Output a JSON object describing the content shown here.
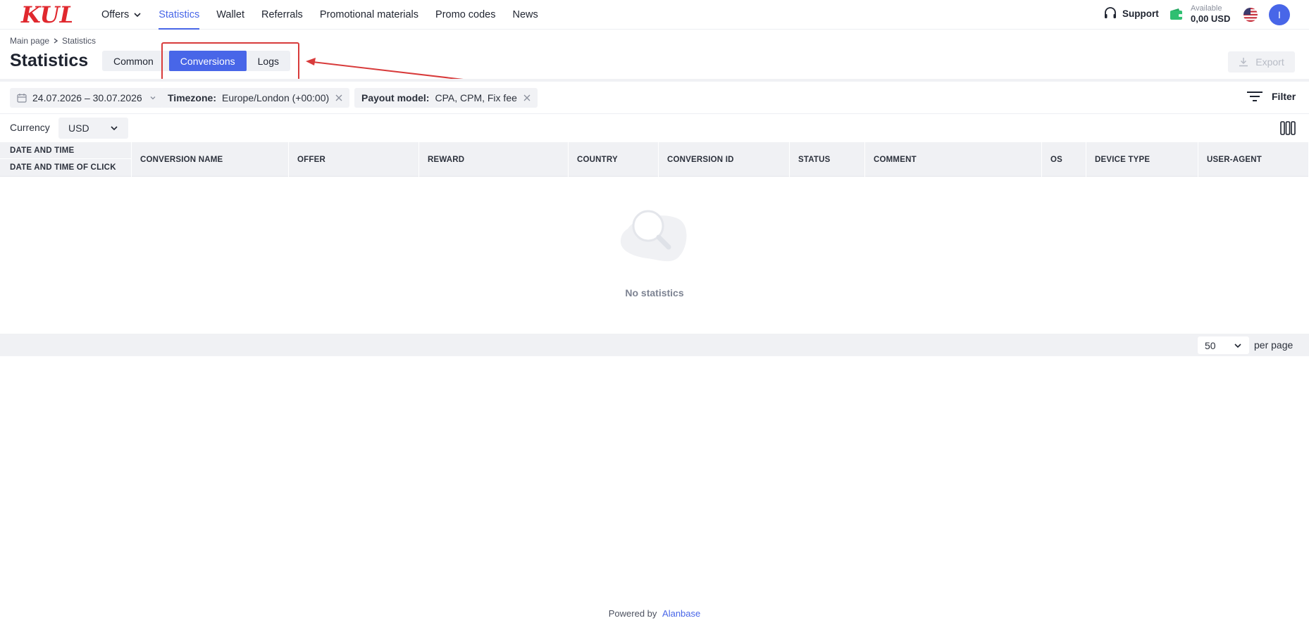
{
  "brand": {
    "logo_text": "KULT",
    "accent": "#4866e8",
    "logo_color": "#e0282e"
  },
  "nav": {
    "items": [
      {
        "label": "Offers",
        "has_dropdown": true
      },
      {
        "label": "Statistics",
        "active": true
      },
      {
        "label": "Wallet"
      },
      {
        "label": "Referrals"
      },
      {
        "label": "Promotional materials"
      },
      {
        "label": "Promo codes"
      },
      {
        "label": "News"
      }
    ]
  },
  "header_right": {
    "support_label": "Support",
    "wallet_label": "Available",
    "wallet_value": "0,00 USD",
    "language_flag": "us-flag-icon",
    "avatar_initial": "I"
  },
  "breadcrumb": {
    "items": [
      "Main page",
      "Statistics"
    ]
  },
  "page": {
    "title": "Statistics",
    "tabs": [
      {
        "label": "Common"
      },
      {
        "label": "Conversions",
        "active": true
      },
      {
        "label": "Logs"
      }
    ],
    "export_label": "Export"
  },
  "filters": {
    "date_range": "24.07.2026 – 30.07.2026",
    "timezone_key": "Timezone:",
    "timezone_value": "Europe/London (+00:00)",
    "payout_key": "Payout model:",
    "payout_value": "CPA, CPM, Fix fee",
    "filter_label": "Filter"
  },
  "currency": {
    "label": "Currency",
    "value": "USD"
  },
  "table": {
    "first_col_top": "DATE AND TIME",
    "first_col_bottom": "DATE AND TIME OF CLICK",
    "columns": [
      "CONVERSION NAME",
      "OFFER",
      "REWARD",
      "COUNTRY",
      "CONVERSION ID",
      "STATUS",
      "COMMENT",
      "OS",
      "DEVICE TYPE",
      "USER-AGENT"
    ],
    "empty_message": "No statistics"
  },
  "pagination": {
    "per_page_value": "50",
    "per_page_label": "per page"
  },
  "footer": {
    "powered_by": "Powered by",
    "vendor": "Alanbase"
  }
}
